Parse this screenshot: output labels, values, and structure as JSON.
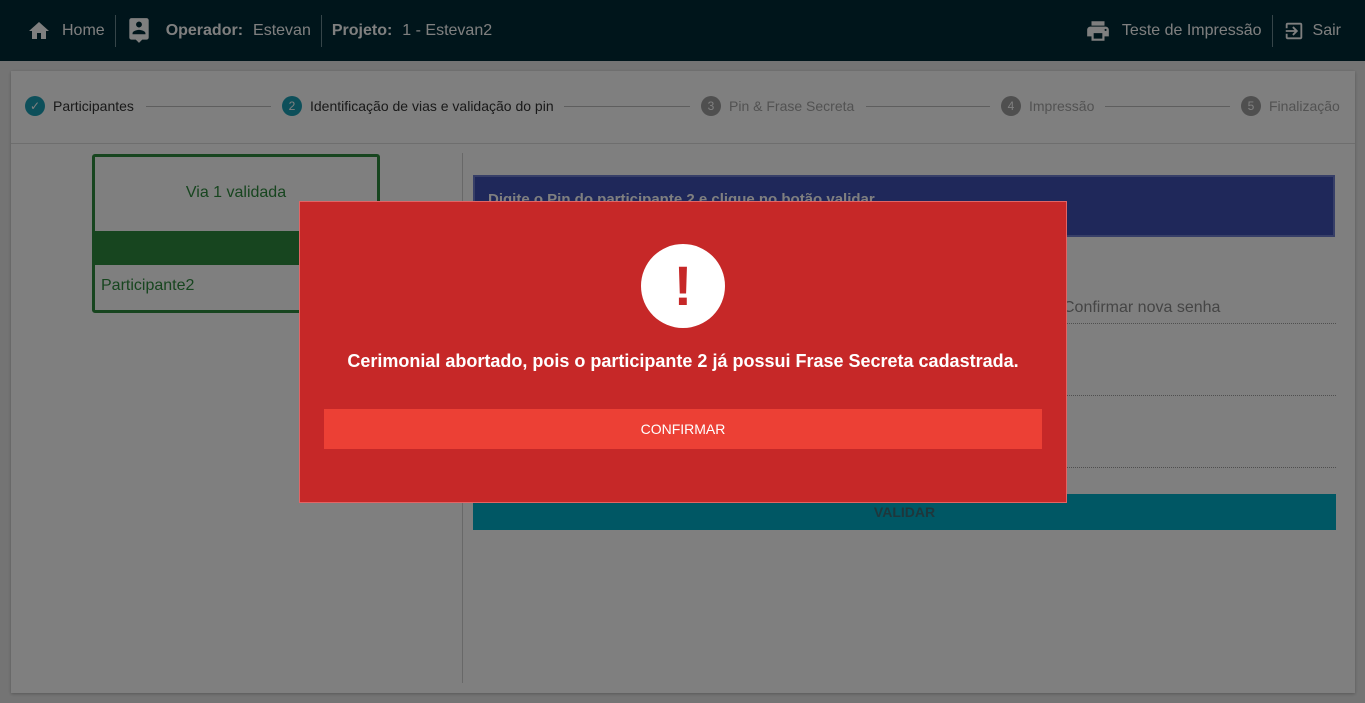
{
  "header": {
    "home_label": "Home",
    "operator_label": "Operador:",
    "operator_value": "Estevan",
    "project_label": "Projeto:",
    "project_value": "1 - Estevan2",
    "print_test_label": "Teste de Impressão",
    "exit_label": "Sair"
  },
  "stepper": {
    "steps": [
      {
        "number": "",
        "label": "Participantes",
        "state": "done"
      },
      {
        "number": "2",
        "label": "Identificação de vias e validação do pin",
        "state": "active"
      },
      {
        "number": "3",
        "label": "Pin & Frase Secreta",
        "state": "todo"
      },
      {
        "number": "4",
        "label": "Impressão",
        "state": "todo"
      },
      {
        "number": "5",
        "label": "Finalização",
        "state": "todo"
      }
    ]
  },
  "via_card": {
    "title": "Via 1 validada",
    "participant": "Participante2"
  },
  "pin_panel": {
    "instruction": "Digite o Pin do participante 2 e clique no botão validar",
    "confirm_password_placeholder": "Confirmar nova senha",
    "validate_label": "VALIDAR"
  },
  "modal": {
    "message": "Cerimonial abortado, pois o participante 2 já possui Frase Secreta cadastrada.",
    "confirm_label": "CONFIRMAR",
    "icon": "exclamation-icon"
  },
  "colors": {
    "topbar": "#002b36",
    "accent": "#1a9fb5",
    "success": "#2e8b3e",
    "modal_bg": "#c62828",
    "modal_button": "#ec4035",
    "info_box": "#3f51b5"
  }
}
